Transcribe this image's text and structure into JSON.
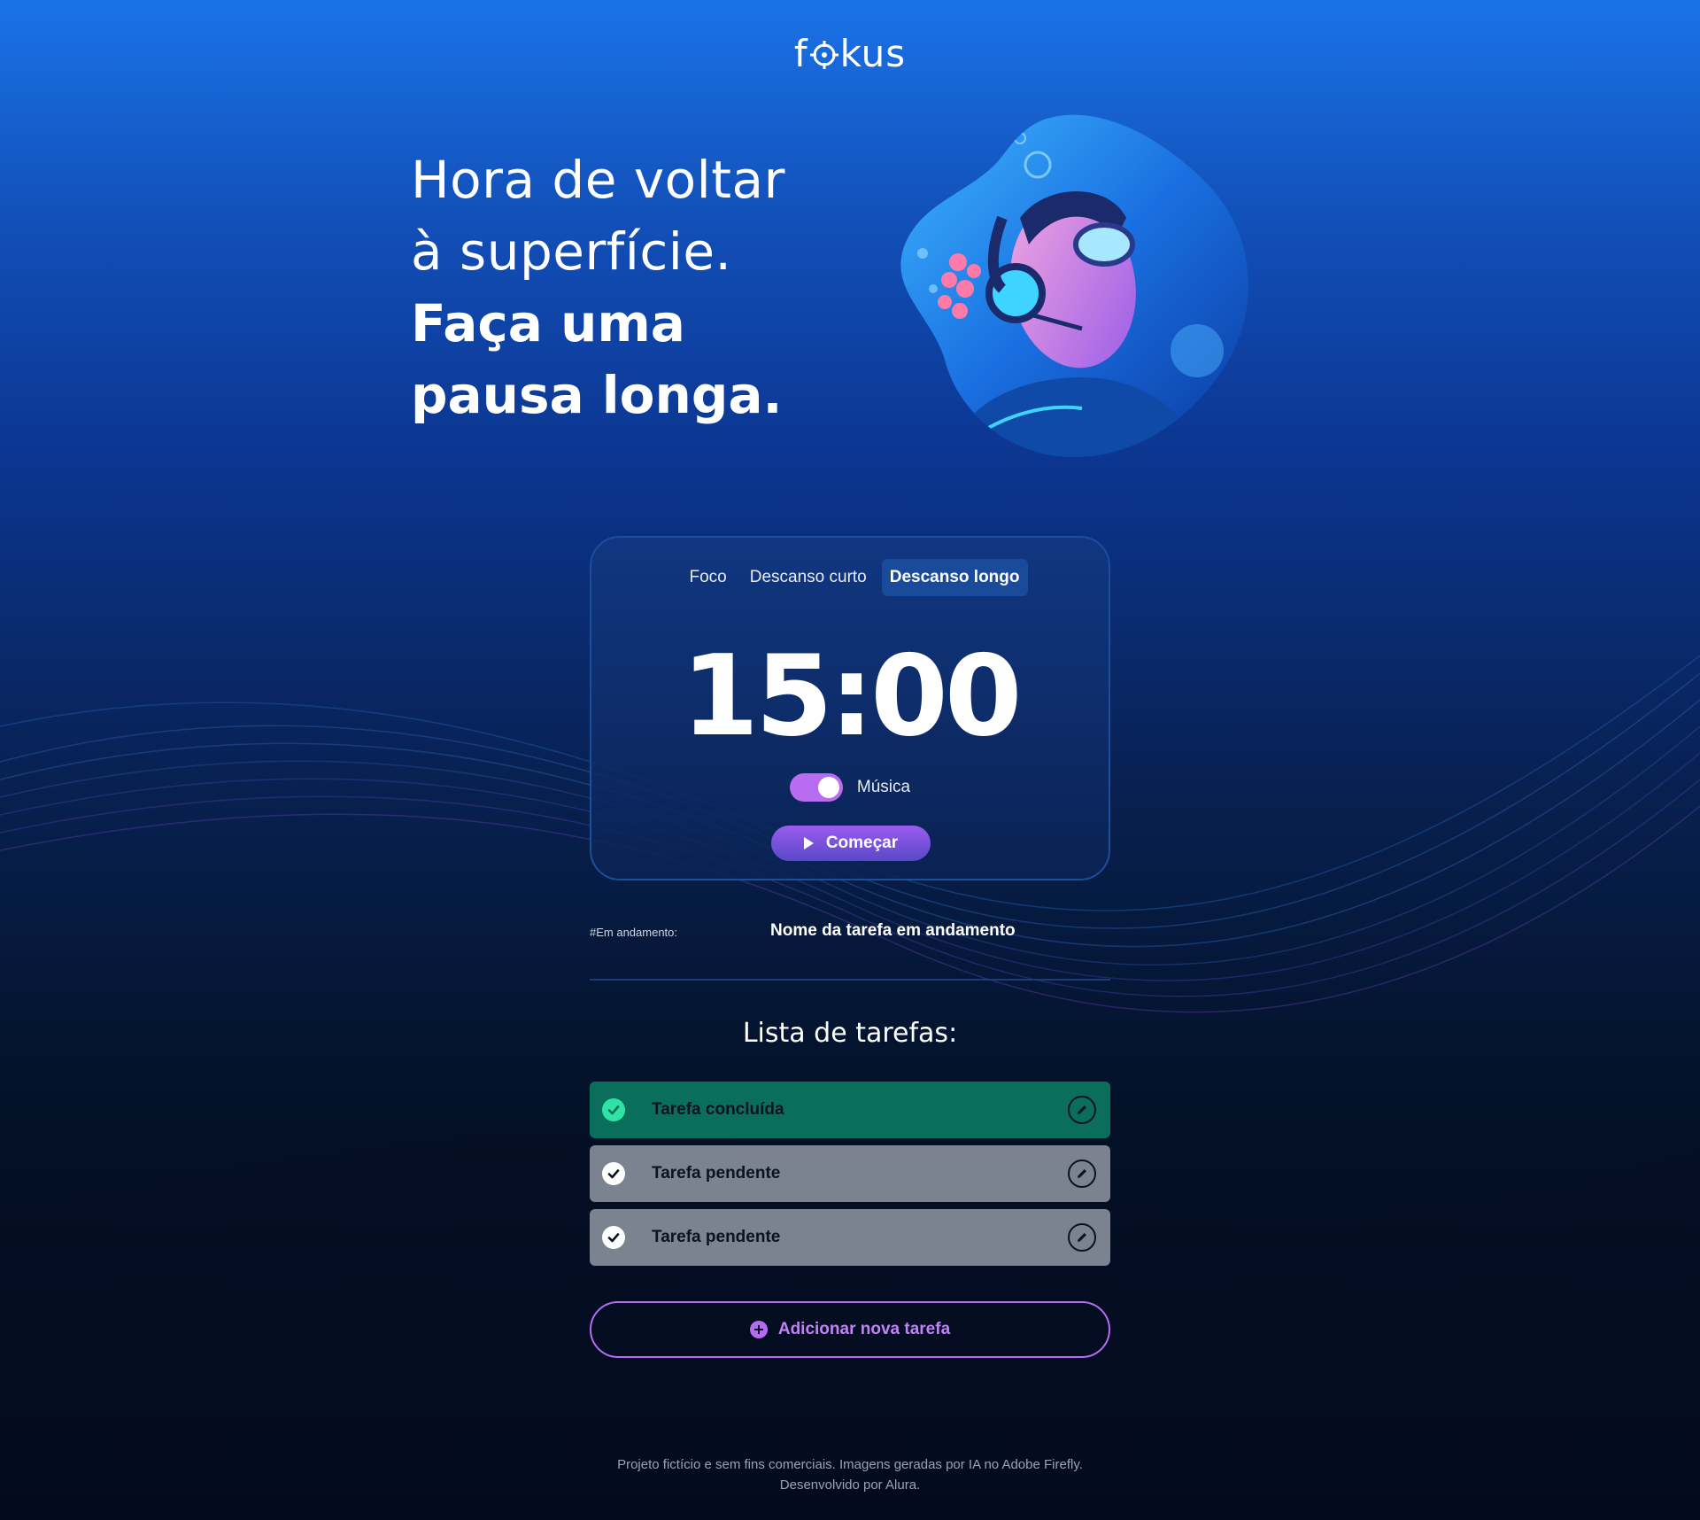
{
  "header": {
    "logo_text_pre": "f",
    "logo_text_post": "kus"
  },
  "hero": {
    "title_light_1": "Hora de voltar",
    "title_light_2": "à superfície.",
    "title_bold_1": "Faça uma",
    "title_bold_2": "pausa longa."
  },
  "timer_card": {
    "tabs": [
      {
        "label": "Foco",
        "active": false
      },
      {
        "label": "Descanso curto",
        "active": false
      },
      {
        "label": "Descanso longo",
        "active": true
      }
    ],
    "time": "15:00",
    "music_label": "Música",
    "music_on": true,
    "start_label": "Começar"
  },
  "current_task": {
    "label": "#Em andamento:",
    "name": "Nome da tarefa em andamento"
  },
  "task_list": {
    "title": "Lista de tarefas:",
    "items": [
      {
        "label": "Tarefa concluída",
        "status": "done"
      },
      {
        "label": "Tarefa pendente",
        "status": "pending"
      },
      {
        "label": "Tarefa pendente",
        "status": "pending"
      }
    ],
    "add_label": "Adicionar nova tarefa"
  },
  "footer": {
    "line1": "Projeto fictício e sem fins comerciais. Imagens geradas por IA no Adobe Firefly.",
    "line2": "Desenvolvido por Alura."
  },
  "colors": {
    "accent": "#b56cf0",
    "done": "#0b6e5c",
    "pending": "#7b8290",
    "check_done": "#2fe3a5"
  }
}
